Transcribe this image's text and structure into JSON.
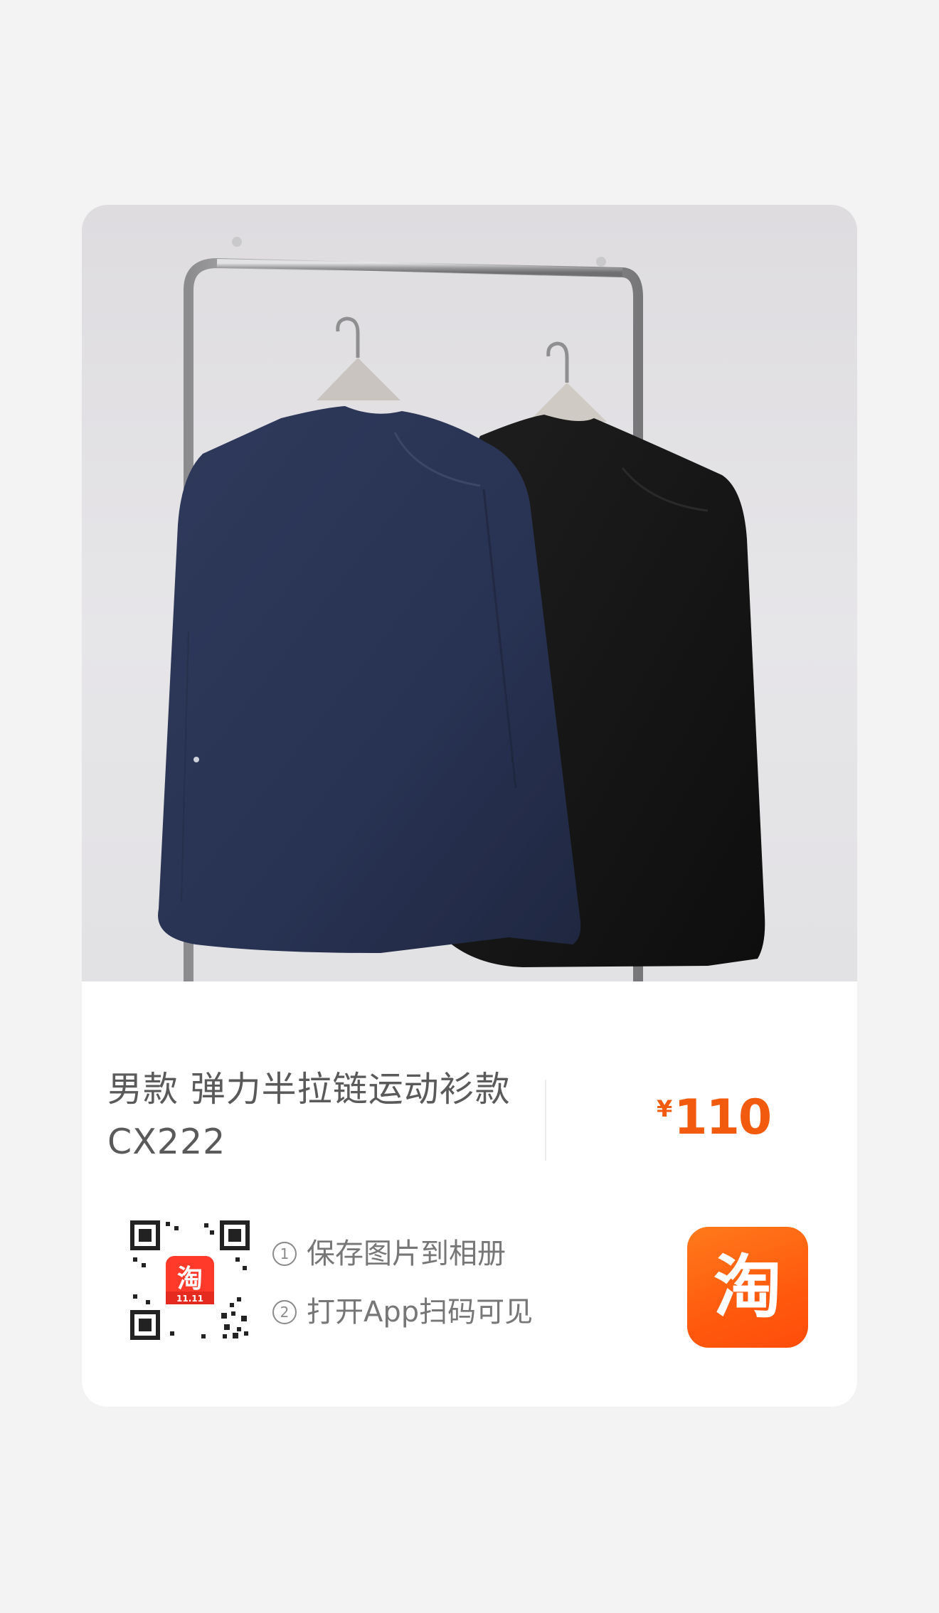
{
  "product": {
    "title_line1": "男款 弹力半拉链运动衫款",
    "title_line2": "CX222",
    "price_currency": "¥",
    "price_value": "110",
    "price_color": "#f25a0d"
  },
  "share": {
    "step1_num": "1",
    "step1_text": "保存图片到相册",
    "step2_num": "2",
    "step2_text": "打开App扫码可见",
    "qr_badge_label": "11.11"
  },
  "icons": {
    "qr_code": "qr-code-icon",
    "taobao_logo": "taobao-logo-icon",
    "logo_glyph": "淘"
  },
  "colors": {
    "background": "#f3f3f3",
    "card": "#ffffff",
    "brand": "#ff5a0e",
    "navy_shirt": "#2b3553",
    "black_shirt": "#161616"
  }
}
